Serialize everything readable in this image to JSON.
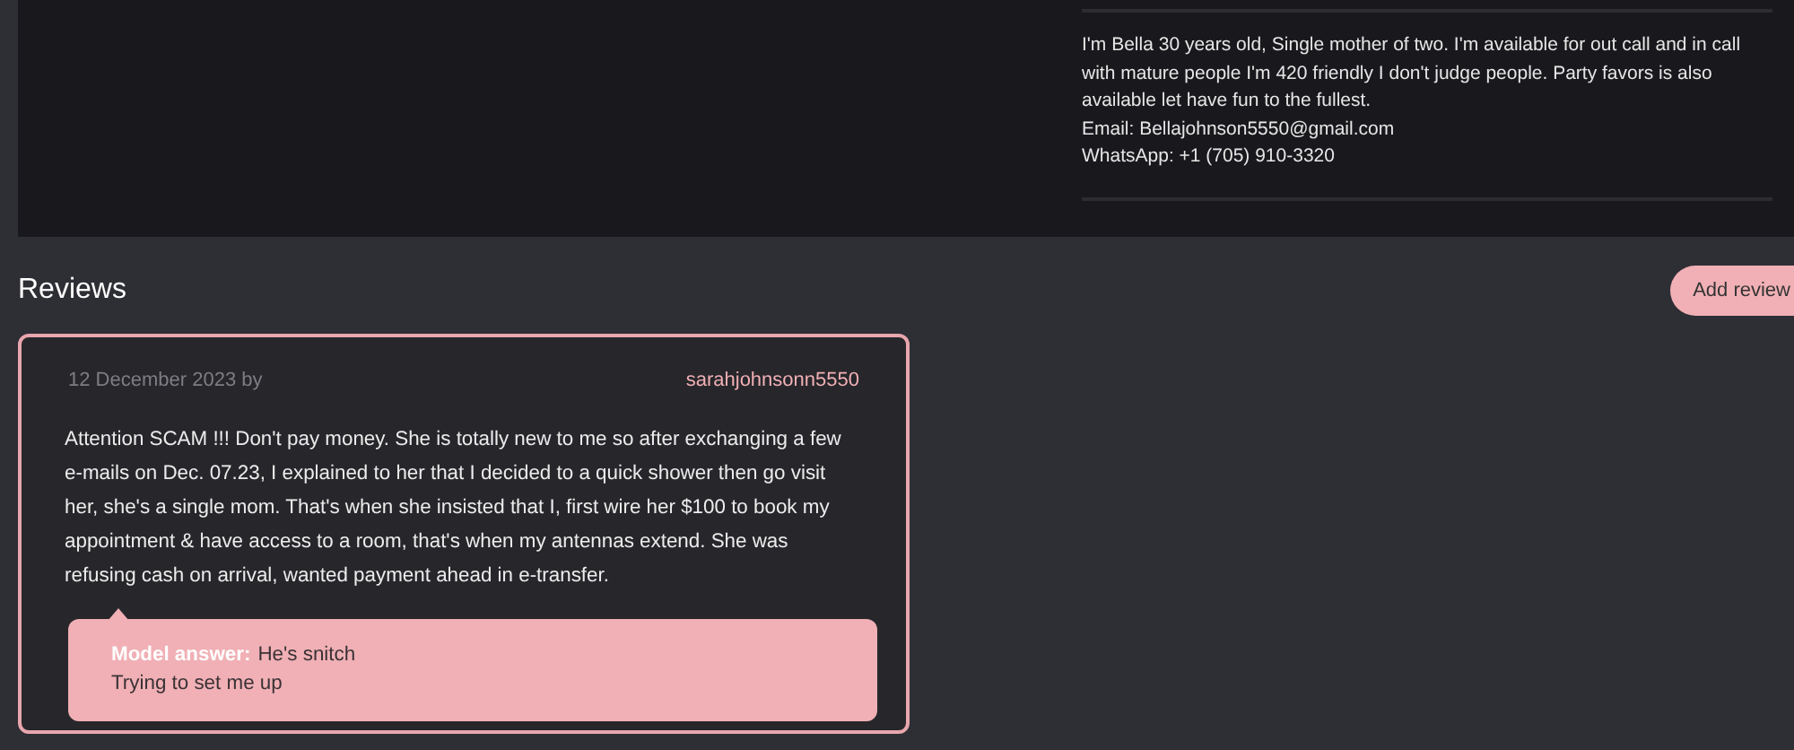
{
  "profile": {
    "about": "I'm Bella 30 years old, Single mother of two. I'm available for out call and in call with mature people I'm 420 friendly I don't judge people. Party favors is also available let have fun to the fullest.",
    "email": "Email: Bellajohnson5550@gmail.com",
    "whatsapp": "WhatsApp: +1 (705) 910-3320"
  },
  "reviews_section": {
    "title": "Reviews",
    "add_button": "Add review"
  },
  "reviews": [
    {
      "date": "12 December 2023 by",
      "author": "sarahjohnsonn5550",
      "text": "Attention SCAM !!! Don't pay money. She is totally new to me so after exchanging a few e-mails on Dec. 07.23, I explained to her that I decided to a quick shower then go visit her, she's a single mom. That's when she insisted that I, first wire her $100 to book my appointment & have access to a room, that's when my antennas extend. She was refusing cash on arrival, wanted payment ahead in e-transfer.",
      "answer": {
        "label": "Model answer:",
        "lines": [
          "He's snitch",
          "Trying to set me up"
        ]
      }
    }
  ]
}
